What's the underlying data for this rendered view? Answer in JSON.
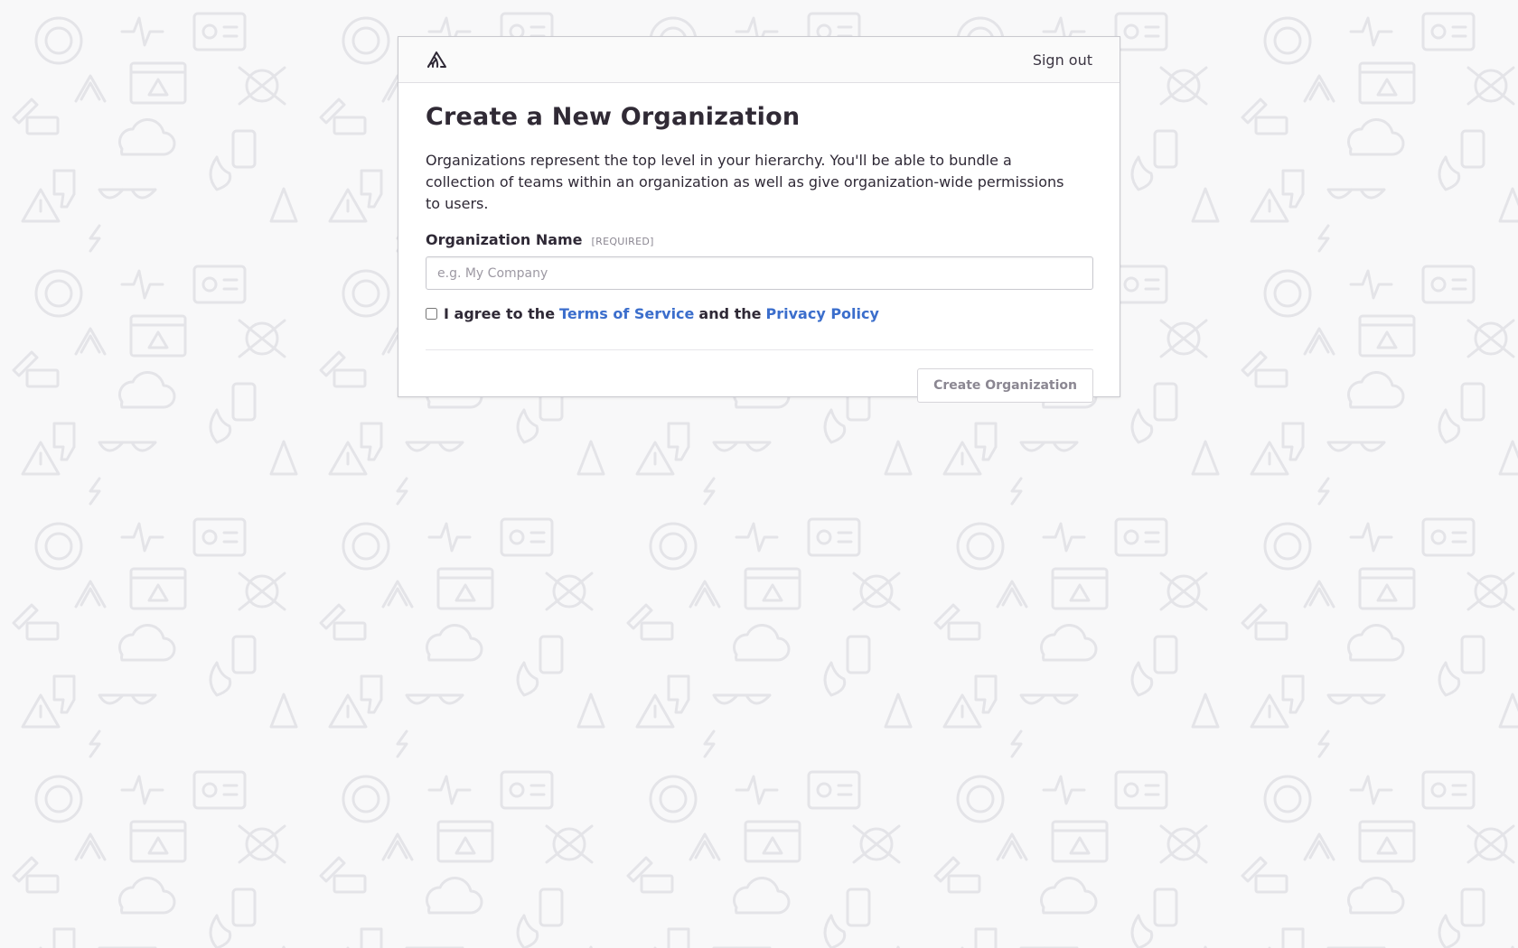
{
  "page": {
    "background_color": "#f8f8f9",
    "pattern_color": "#e7e7ea"
  },
  "header": {
    "logo_icon": "sentry-logo-icon",
    "signout_label": "Sign out"
  },
  "form": {
    "title": "Create a New Organization",
    "description": "Organizations represent the top level in your hierarchy. You'll be able to bundle a collection of teams within an organization as well as give organization-wide permissions to users.",
    "org_name_label": "Organization Name",
    "required_tag": "[REQUIRED]",
    "org_name_value": "",
    "org_name_placeholder": "e.g. My Company",
    "agree_prefix": "I agree to the",
    "terms_link": "Terms of Service",
    "agree_middle": "and the",
    "privacy_link": "Privacy Policy",
    "agree_checked": false,
    "submit_label": "Create Organization"
  },
  "colors": {
    "link": "#3b6ecc",
    "text": "#2f2936",
    "muted": "#8b8792"
  }
}
